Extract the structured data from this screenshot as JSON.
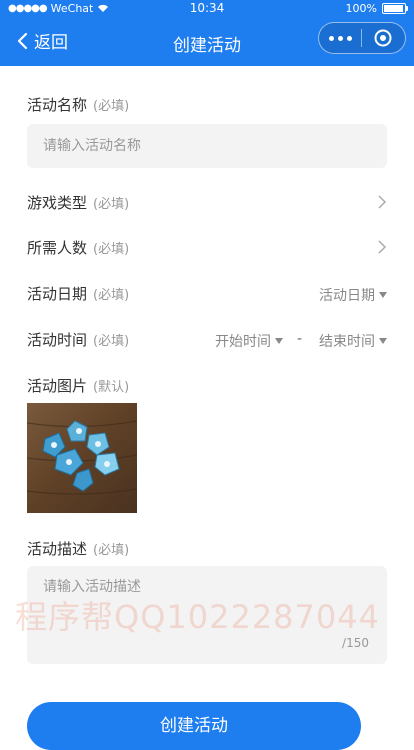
{
  "status_bar": {
    "carrier": "WeChat",
    "time": "10:34",
    "battery": "100%"
  },
  "nav": {
    "back_label": "返回",
    "title": "创建活动"
  },
  "form": {
    "name": {
      "label": "活动名称",
      "required": "(必填)",
      "placeholder": "请输入活动名称",
      "value": ""
    },
    "game_type": {
      "label": "游戏类型",
      "required": "(必填)"
    },
    "people": {
      "label": "所需人数",
      "required": "(必填)"
    },
    "date": {
      "label": "活动日期",
      "required": "(必填)",
      "picker": "活动日期"
    },
    "time": {
      "label": "活动时间",
      "required": "(必填)",
      "start": "开始时间",
      "separator": "-",
      "end": "结束时间"
    },
    "image": {
      "label": "活动图片",
      "note": "(默认)"
    },
    "description": {
      "label": "活动描述",
      "required": "(必填)",
      "placeholder": "请输入活动描述",
      "value": "",
      "counter": "/150"
    }
  },
  "watermark": "程序帮QQ1022287044",
  "submit_label": "创建活动",
  "colors": {
    "brand": "#1e7ef0",
    "field_bg": "#f3f3f3"
  }
}
